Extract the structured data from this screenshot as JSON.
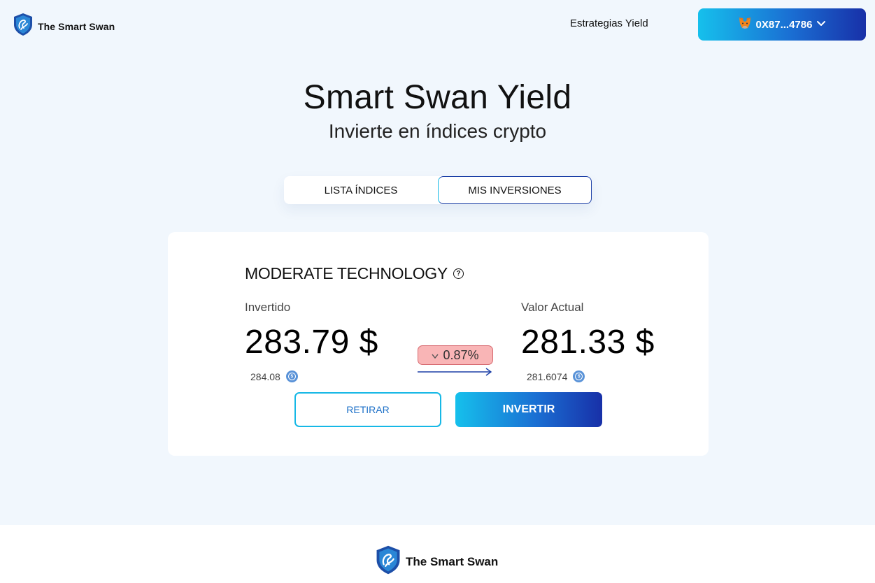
{
  "brand": {
    "name": "The Smart Swan"
  },
  "nav": {
    "strategies_label": "Estrategias Yield"
  },
  "wallet": {
    "address": "0X87...4786"
  },
  "hero": {
    "title": "Smart Swan Yield",
    "subtitle": "Invierte en índices crypto"
  },
  "tabs": [
    {
      "label": "LISTA ÍNDICES",
      "active": false
    },
    {
      "label": "MIS INVERSIONES",
      "active": true
    }
  ],
  "investment": {
    "name": "MODERATE TECHNOLOGY",
    "invested_label": "Invertido",
    "invested_value": "283.79 $",
    "invested_tokens": "284.08",
    "current_label": "Valor Actual",
    "current_value": "281.33 $",
    "current_tokens": "281.6074",
    "change": "0.87%",
    "change_direction": "down",
    "retirar_label": "RETIRAR",
    "invertir_label": "INVERTIR"
  },
  "footer": {
    "brand_name": "The Smart Swan"
  },
  "colors": {
    "accent_cyan": "#16c0ec",
    "accent_blue": "#1830a8",
    "negative_bg": "#f9b5b6",
    "page_bg": "#f1f7fd"
  }
}
